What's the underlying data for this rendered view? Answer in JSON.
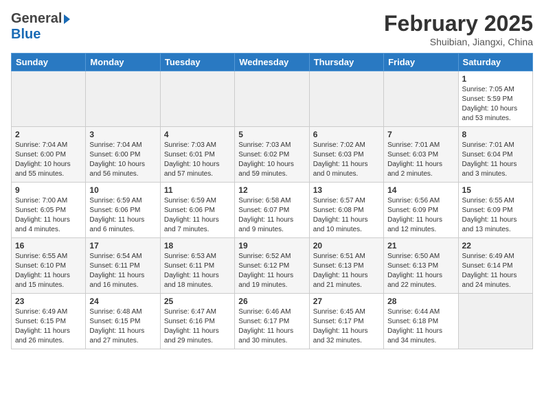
{
  "header": {
    "logo_general": "General",
    "logo_blue": "Blue",
    "month_title": "February 2025",
    "subtitle": "Shuibian, Jiangxi, China"
  },
  "weekdays": [
    "Sunday",
    "Monday",
    "Tuesday",
    "Wednesday",
    "Thursday",
    "Friday",
    "Saturday"
  ],
  "weeks": [
    [
      {
        "day": "",
        "info": ""
      },
      {
        "day": "",
        "info": ""
      },
      {
        "day": "",
        "info": ""
      },
      {
        "day": "",
        "info": ""
      },
      {
        "day": "",
        "info": ""
      },
      {
        "day": "",
        "info": ""
      },
      {
        "day": "1",
        "info": "Sunrise: 7:05 AM\nSunset: 5:59 PM\nDaylight: 10 hours and 53 minutes."
      }
    ],
    [
      {
        "day": "2",
        "info": "Sunrise: 7:04 AM\nSunset: 6:00 PM\nDaylight: 10 hours and 55 minutes."
      },
      {
        "day": "3",
        "info": "Sunrise: 7:04 AM\nSunset: 6:00 PM\nDaylight: 10 hours and 56 minutes."
      },
      {
        "day": "4",
        "info": "Sunrise: 7:03 AM\nSunset: 6:01 PM\nDaylight: 10 hours and 57 minutes."
      },
      {
        "day": "5",
        "info": "Sunrise: 7:03 AM\nSunset: 6:02 PM\nDaylight: 10 hours and 59 minutes."
      },
      {
        "day": "6",
        "info": "Sunrise: 7:02 AM\nSunset: 6:03 PM\nDaylight: 11 hours and 0 minutes."
      },
      {
        "day": "7",
        "info": "Sunrise: 7:01 AM\nSunset: 6:03 PM\nDaylight: 11 hours and 2 minutes."
      },
      {
        "day": "8",
        "info": "Sunrise: 7:01 AM\nSunset: 6:04 PM\nDaylight: 11 hours and 3 minutes."
      }
    ],
    [
      {
        "day": "9",
        "info": "Sunrise: 7:00 AM\nSunset: 6:05 PM\nDaylight: 11 hours and 4 minutes."
      },
      {
        "day": "10",
        "info": "Sunrise: 6:59 AM\nSunset: 6:06 PM\nDaylight: 11 hours and 6 minutes."
      },
      {
        "day": "11",
        "info": "Sunrise: 6:59 AM\nSunset: 6:06 PM\nDaylight: 11 hours and 7 minutes."
      },
      {
        "day": "12",
        "info": "Sunrise: 6:58 AM\nSunset: 6:07 PM\nDaylight: 11 hours and 9 minutes."
      },
      {
        "day": "13",
        "info": "Sunrise: 6:57 AM\nSunset: 6:08 PM\nDaylight: 11 hours and 10 minutes."
      },
      {
        "day": "14",
        "info": "Sunrise: 6:56 AM\nSunset: 6:09 PM\nDaylight: 11 hours and 12 minutes."
      },
      {
        "day": "15",
        "info": "Sunrise: 6:55 AM\nSunset: 6:09 PM\nDaylight: 11 hours and 13 minutes."
      }
    ],
    [
      {
        "day": "16",
        "info": "Sunrise: 6:55 AM\nSunset: 6:10 PM\nDaylight: 11 hours and 15 minutes."
      },
      {
        "day": "17",
        "info": "Sunrise: 6:54 AM\nSunset: 6:11 PM\nDaylight: 11 hours and 16 minutes."
      },
      {
        "day": "18",
        "info": "Sunrise: 6:53 AM\nSunset: 6:11 PM\nDaylight: 11 hours and 18 minutes."
      },
      {
        "day": "19",
        "info": "Sunrise: 6:52 AM\nSunset: 6:12 PM\nDaylight: 11 hours and 19 minutes."
      },
      {
        "day": "20",
        "info": "Sunrise: 6:51 AM\nSunset: 6:13 PM\nDaylight: 11 hours and 21 minutes."
      },
      {
        "day": "21",
        "info": "Sunrise: 6:50 AM\nSunset: 6:13 PM\nDaylight: 11 hours and 22 minutes."
      },
      {
        "day": "22",
        "info": "Sunrise: 6:49 AM\nSunset: 6:14 PM\nDaylight: 11 hours and 24 minutes."
      }
    ],
    [
      {
        "day": "23",
        "info": "Sunrise: 6:49 AM\nSunset: 6:15 PM\nDaylight: 11 hours and 26 minutes."
      },
      {
        "day": "24",
        "info": "Sunrise: 6:48 AM\nSunset: 6:15 PM\nDaylight: 11 hours and 27 minutes."
      },
      {
        "day": "25",
        "info": "Sunrise: 6:47 AM\nSunset: 6:16 PM\nDaylight: 11 hours and 29 minutes."
      },
      {
        "day": "26",
        "info": "Sunrise: 6:46 AM\nSunset: 6:17 PM\nDaylight: 11 hours and 30 minutes."
      },
      {
        "day": "27",
        "info": "Sunrise: 6:45 AM\nSunset: 6:17 PM\nDaylight: 11 hours and 32 minutes."
      },
      {
        "day": "28",
        "info": "Sunrise: 6:44 AM\nSunset: 6:18 PM\nDaylight: 11 hours and 34 minutes."
      },
      {
        "day": "",
        "info": ""
      }
    ]
  ]
}
